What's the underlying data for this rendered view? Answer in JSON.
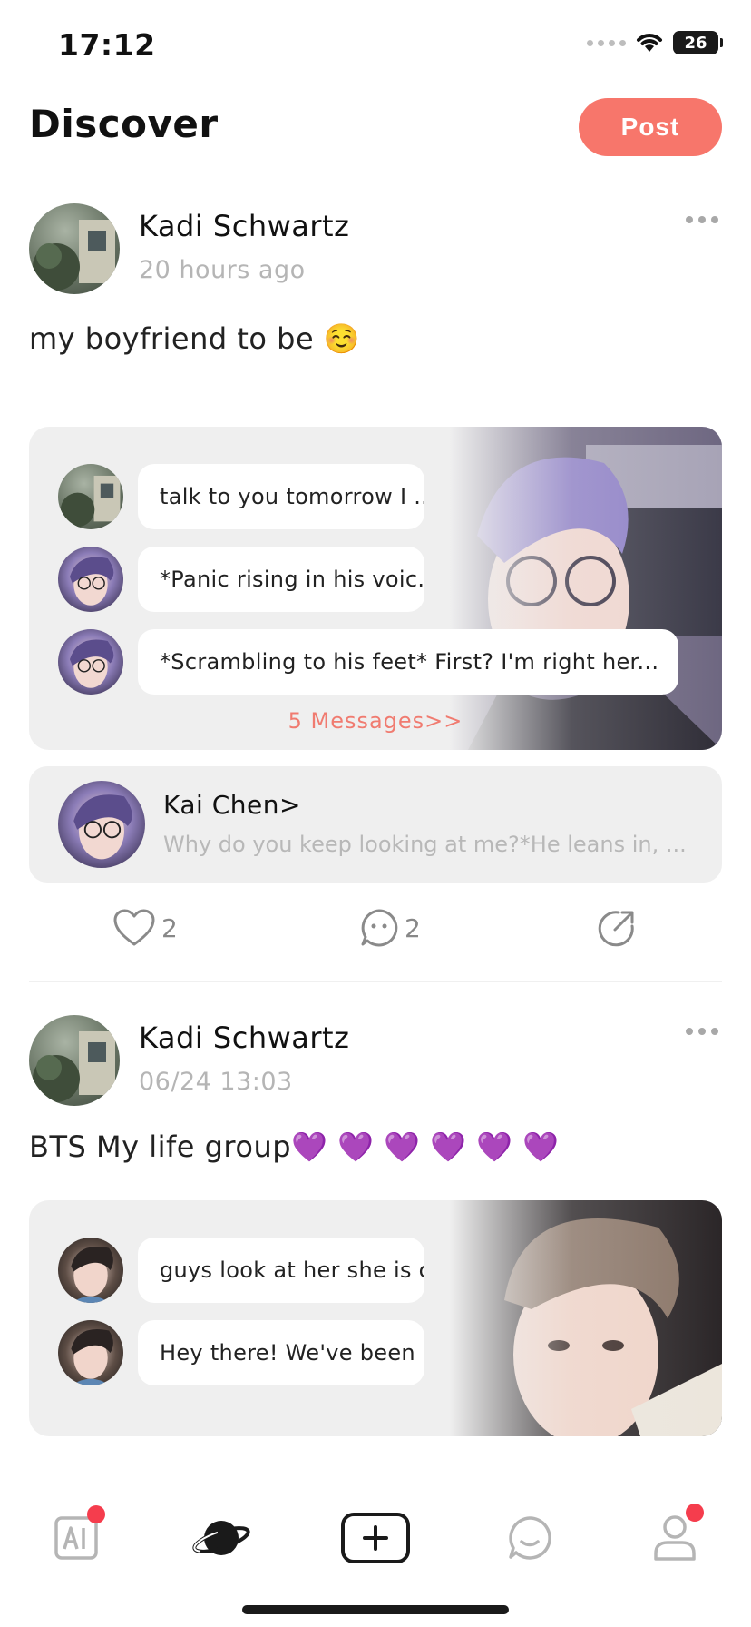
{
  "status_bar": {
    "time": "17:12",
    "battery": "26"
  },
  "header": {
    "title": "Discover",
    "post_label": "Post"
  },
  "posts": [
    {
      "author": "Kadi Schwartz",
      "time": "20 hours ago",
      "text": "my boyfriend to be ☺️",
      "messages": [
        "talk to you tomorrow I ...",
        "*Panic rising in his voic...",
        "*Scrambling to his feet* First? I'm right her..."
      ],
      "messages_link": "5  Messages>>",
      "character": {
        "name": "Kai Chen>",
        "preview": "Why do you keep looking at me?*He leans in, ..."
      },
      "likes": "2",
      "comments": "2"
    },
    {
      "author": "Kadi Schwartz",
      "time": "06/24 13:03",
      "text": "BTS My life group💜 💜 💜 💜 💜 💜",
      "messages": [
        "guys look at her she is c...",
        "Hey there! We've been ..."
      ]
    }
  ],
  "colors": {
    "accent": "#f7766b",
    "link": "#f07b70",
    "badge": "#f53d4d",
    "card_bg": "#efefef"
  },
  "tabbar": {
    "tabs": [
      {
        "name": "ai",
        "icon": "ai-icon",
        "badge": true
      },
      {
        "name": "discover",
        "icon": "planet-icon",
        "active": true
      },
      {
        "name": "create",
        "icon": "plus-square-icon"
      },
      {
        "name": "messages",
        "icon": "chat-bubble-icon"
      },
      {
        "name": "profile",
        "icon": "person-icon",
        "badge": true
      }
    ]
  }
}
